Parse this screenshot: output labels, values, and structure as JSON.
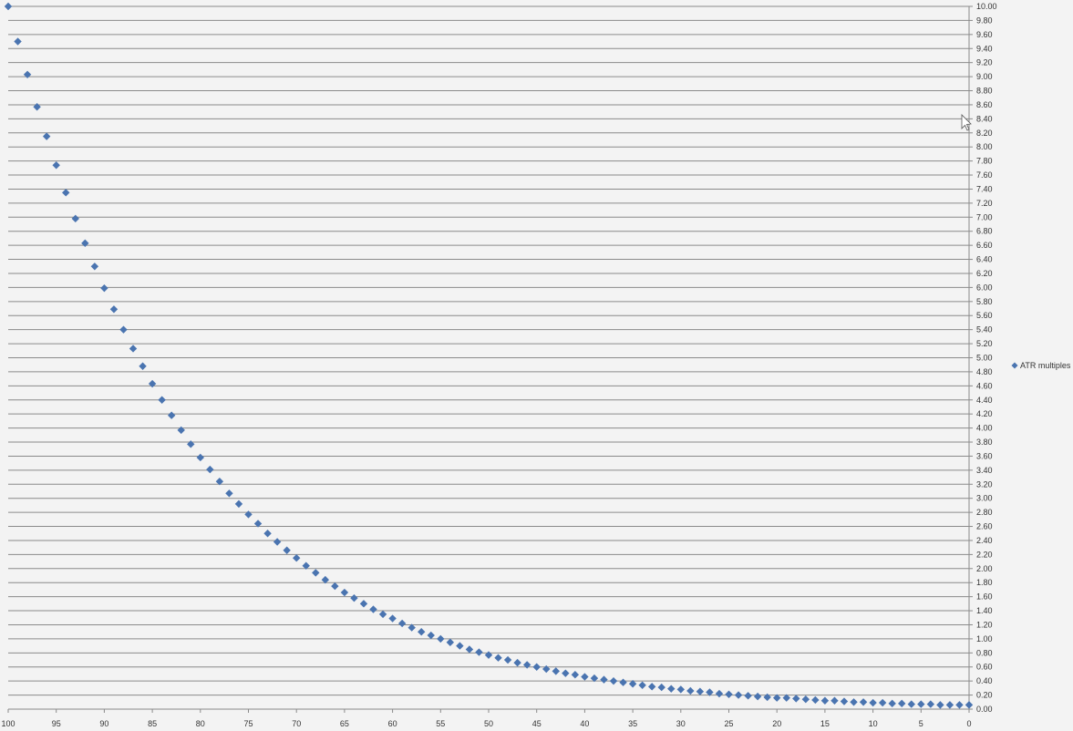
{
  "chart_data": {
    "type": "scatter",
    "title": "",
    "xlabel": "",
    "ylabel": "",
    "xlim": [
      100,
      0
    ],
    "x_reversed": true,
    "ylim": [
      0,
      10
    ],
    "y_axis_side": "right",
    "grid": "horizontal",
    "legend_position": "right",
    "x_ticks": [
      "100",
      "95",
      "90",
      "85",
      "80",
      "75",
      "70",
      "65",
      "60",
      "55",
      "50",
      "45",
      "40",
      "35",
      "30",
      "25",
      "20",
      "15",
      "10",
      "5",
      "0"
    ],
    "y_ticks": [
      "0.00",
      "0.20",
      "0.40",
      "0.60",
      "0.80",
      "1.00",
      "1.20",
      "1.40",
      "1.60",
      "1.80",
      "2.00",
      "2.20",
      "2.40",
      "2.60",
      "2.80",
      "3.00",
      "3.20",
      "3.40",
      "3.60",
      "3.80",
      "4.00",
      "4.20",
      "4.40",
      "4.60",
      "4.80",
      "5.00",
      "5.20",
      "5.40",
      "5.60",
      "5.80",
      "6.00",
      "6.20",
      "6.40",
      "6.60",
      "6.80",
      "7.00",
      "7.20",
      "7.40",
      "7.60",
      "7.80",
      "8.00",
      "8.20",
      "8.40",
      "8.60",
      "8.80",
      "9.00",
      "9.20",
      "9.40",
      "9.60",
      "9.80",
      "10.00"
    ],
    "series": [
      {
        "name": "ATR multiples",
        "color": "#4a74b0",
        "marker": "diamond",
        "x": [
          100,
          99,
          98,
          97,
          96,
          95,
          94,
          93,
          92,
          91,
          90,
          89,
          88,
          87,
          86,
          85,
          84,
          83,
          82,
          81,
          80,
          79,
          78,
          77,
          76,
          75,
          74,
          73,
          72,
          71,
          70,
          69,
          68,
          67,
          66,
          65,
          64,
          63,
          62,
          61,
          60,
          59,
          58,
          57,
          56,
          55,
          54,
          53,
          52,
          51,
          50,
          49,
          48,
          47,
          46,
          45,
          44,
          43,
          42,
          41,
          40,
          39,
          38,
          37,
          36,
          35,
          34,
          33,
          32,
          31,
          30,
          29,
          28,
          27,
          26,
          25,
          24,
          23,
          22,
          21,
          20,
          19,
          18,
          17,
          16,
          15,
          14,
          13,
          12,
          11,
          10,
          9,
          8,
          7,
          6,
          5,
          4,
          3,
          2,
          1,
          0
        ],
        "values": [
          10.0,
          9.5,
          9.03,
          8.57,
          8.15,
          7.74,
          7.35,
          6.98,
          6.63,
          6.3,
          5.99,
          5.69,
          5.4,
          5.13,
          4.88,
          4.63,
          4.4,
          4.18,
          3.97,
          3.77,
          3.58,
          3.41,
          3.24,
          3.07,
          2.92,
          2.77,
          2.64,
          2.5,
          2.38,
          2.26,
          2.15,
          2.04,
          1.94,
          1.84,
          1.75,
          1.66,
          1.58,
          1.5,
          1.42,
          1.35,
          1.29,
          1.22,
          1.16,
          1.1,
          1.05,
          1.0,
          0.95,
          0.9,
          0.85,
          0.81,
          0.77,
          0.73,
          0.7,
          0.66,
          0.63,
          0.6,
          0.57,
          0.54,
          0.51,
          0.49,
          0.46,
          0.44,
          0.42,
          0.4,
          0.38,
          0.36,
          0.34,
          0.32,
          0.31,
          0.29,
          0.28,
          0.26,
          0.25,
          0.24,
          0.22,
          0.21,
          0.2,
          0.19,
          0.18,
          0.17,
          0.16,
          0.16,
          0.15,
          0.14,
          0.13,
          0.12,
          0.12,
          0.11,
          0.1,
          0.1,
          0.09,
          0.09,
          0.08,
          0.08,
          0.07,
          0.07,
          0.07,
          0.06,
          0.06,
          0.06,
          0.06
        ]
      }
    ]
  }
}
